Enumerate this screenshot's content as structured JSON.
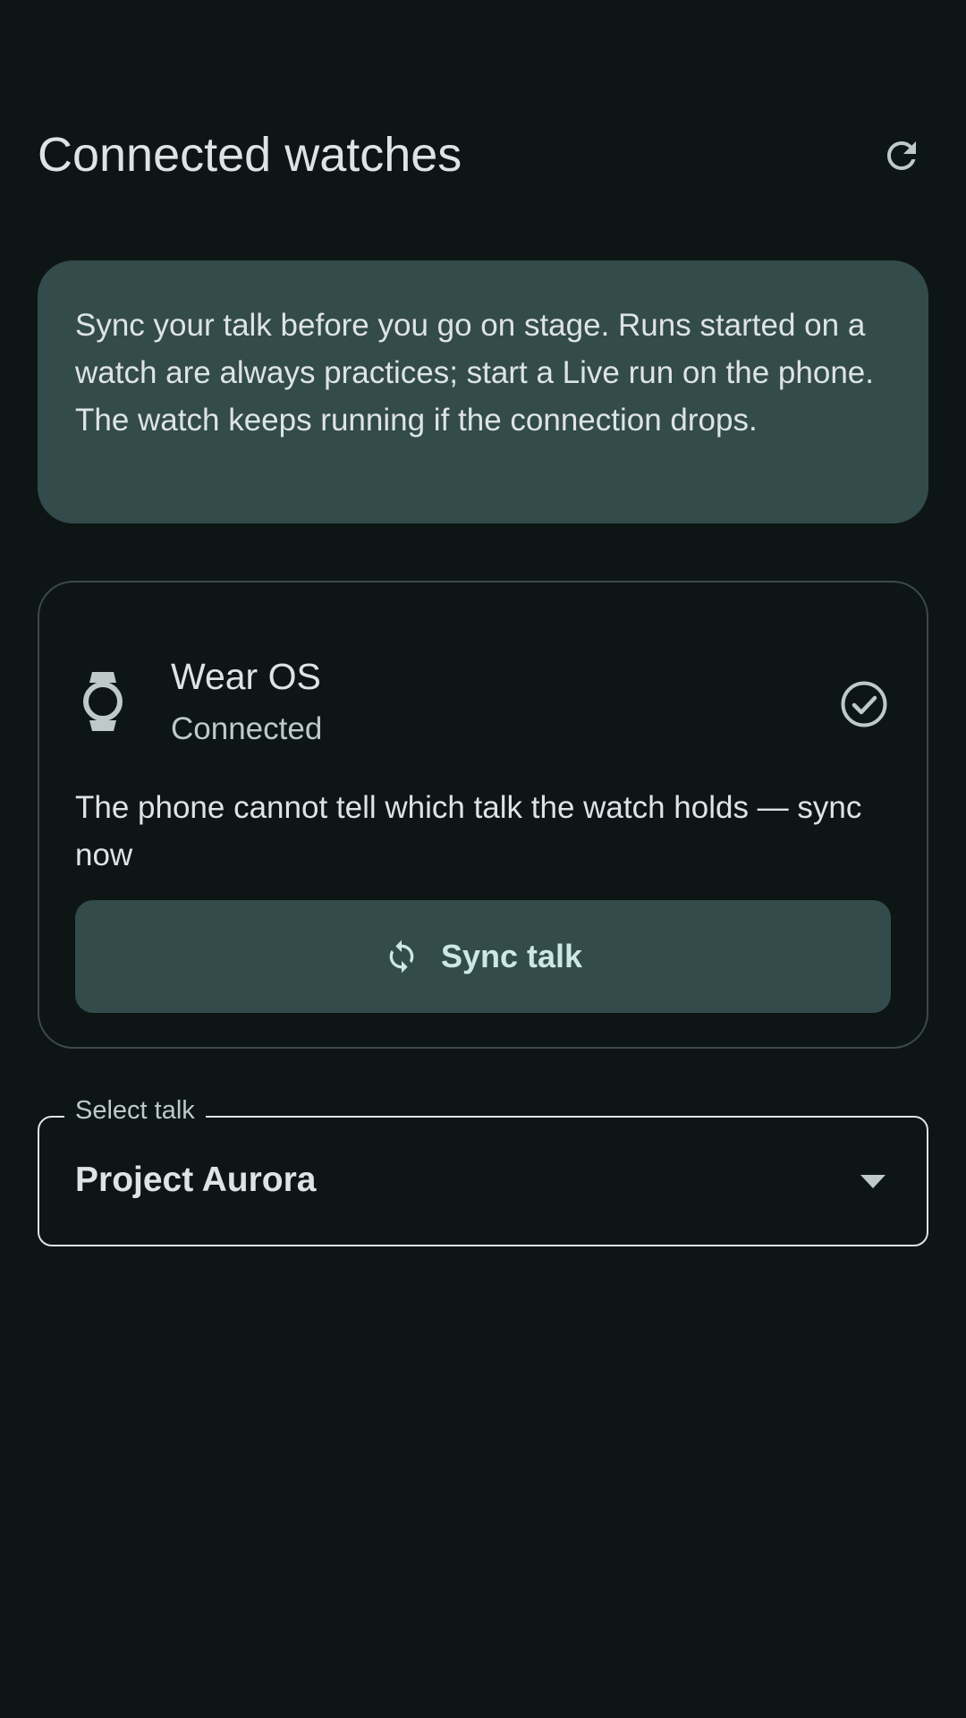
{
  "header": {
    "title": "Connected watches",
    "refresh_icon": "refresh-icon"
  },
  "info_card": {
    "text": "Sync your talk before you go on stage. Runs started on a watch are always practices; start a Live run on the phone. The watch keeps running if the connection drops."
  },
  "device": {
    "name": "Wear OS",
    "status": "Connected",
    "icon": "watch-icon",
    "status_icon": "check-circle-icon",
    "message": "The phone cannot tell which talk the watch holds — sync now",
    "sync_button": {
      "label": "Sync talk",
      "icon": "sync-icon"
    }
  },
  "talk_select": {
    "label": "Select talk",
    "value": "Project Aurora",
    "icon": "chevron-down-icon"
  },
  "colors": {
    "background": "#0e1515",
    "card": "#334b4a",
    "outline": "#3f4948",
    "on_surface": "#dde4e3",
    "button_text": "#cce8e6"
  }
}
